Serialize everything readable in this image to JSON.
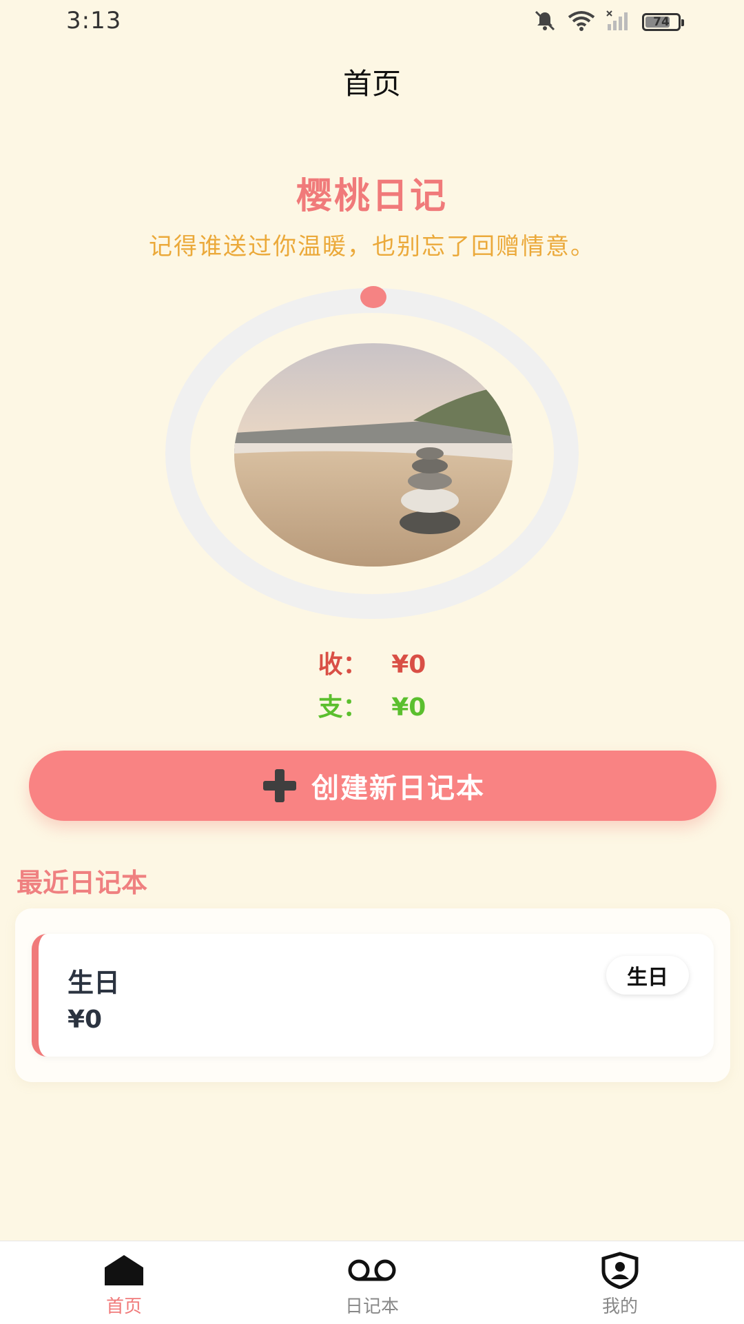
{
  "status_bar": {
    "time": "3:13",
    "battery": "74",
    "icons": [
      "mute-icon",
      "wifi-icon",
      "signal-icon",
      "battery-icon"
    ]
  },
  "header": {
    "title": "首页"
  },
  "hero": {
    "app_name": "樱桃日记",
    "slogan": "记得谁送过你温暖，也别忘了回赠情意。"
  },
  "summary": {
    "income_label": "收：",
    "income_value": "¥0",
    "expense_label": "支：",
    "expense_value": "¥0"
  },
  "actions": {
    "create_label": "创建新日记本",
    "create_icon": "plus-icon"
  },
  "recent": {
    "title": "最近日记本",
    "items": [
      {
        "name": "生日",
        "amount": "¥0",
        "tag": "生日"
      }
    ]
  },
  "tabs": [
    {
      "label": "首页",
      "icon": "home-icon",
      "active": true
    },
    {
      "label": "日记本",
      "icon": "voicemail-icon",
      "active": false
    },
    {
      "label": "我的",
      "icon": "profile-shield-icon",
      "active": false
    }
  ],
  "colors": {
    "background": "#FDF7E4",
    "accent": "#F07A7A",
    "slogan": "#EBA93A",
    "income": "#D94F45",
    "expense": "#5BBF2E",
    "button": "#F98383"
  }
}
